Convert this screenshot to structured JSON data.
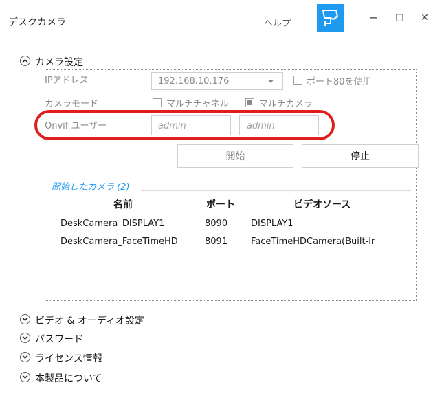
{
  "window": {
    "title": "デスクカメラ",
    "help": "ヘルプ",
    "controls": {
      "minimize": "−",
      "maximize": "□",
      "close": "✕"
    }
  },
  "sections": {
    "camera_settings": "カメラ設定",
    "video_audio": "ビデオ & オーディオ設定",
    "password": "パスワード",
    "license": "ライセンス情報",
    "about": "本製品について"
  },
  "camera_settings": {
    "ip_label": "IPアドレス",
    "ip_value": "192.168.10.176",
    "port80_label": "ポート80を使用",
    "port80_checked": false,
    "mode_label": "カメラモード",
    "multichannel_label": "マルチチャネル",
    "multichannel_checked": false,
    "multicamera_label": "マルチカメラ",
    "multicamera_checked": true,
    "onvif_label": "Onvif ユーザー",
    "onvif_user_placeholder": "admin",
    "onvif_pass_placeholder": "admin",
    "start_label": "開始",
    "stop_label": "停止"
  },
  "started_cameras": {
    "legend": "開始したカメラ (2)",
    "columns": [
      "名前",
      "ポート",
      "ビデオソース"
    ],
    "rows": [
      [
        "DeskCamera_DISPLAY1",
        "8090",
        "DISPLAY1"
      ],
      [
        "DeskCamera_FaceTimeHD",
        "8091",
        "FaceTimeHDCamera(Built-ir"
      ]
    ]
  },
  "colors": {
    "accent": "#1e9bf0",
    "annotation": "#e01e1e",
    "disabled_text": "#8a8a8a"
  },
  "icons": {
    "camera_toggle": "security-camera-icon",
    "dropdown": "chevron-down-icon",
    "expand": "chevron-up-circle-icon",
    "collapse": "chevron-down-circle-icon"
  }
}
